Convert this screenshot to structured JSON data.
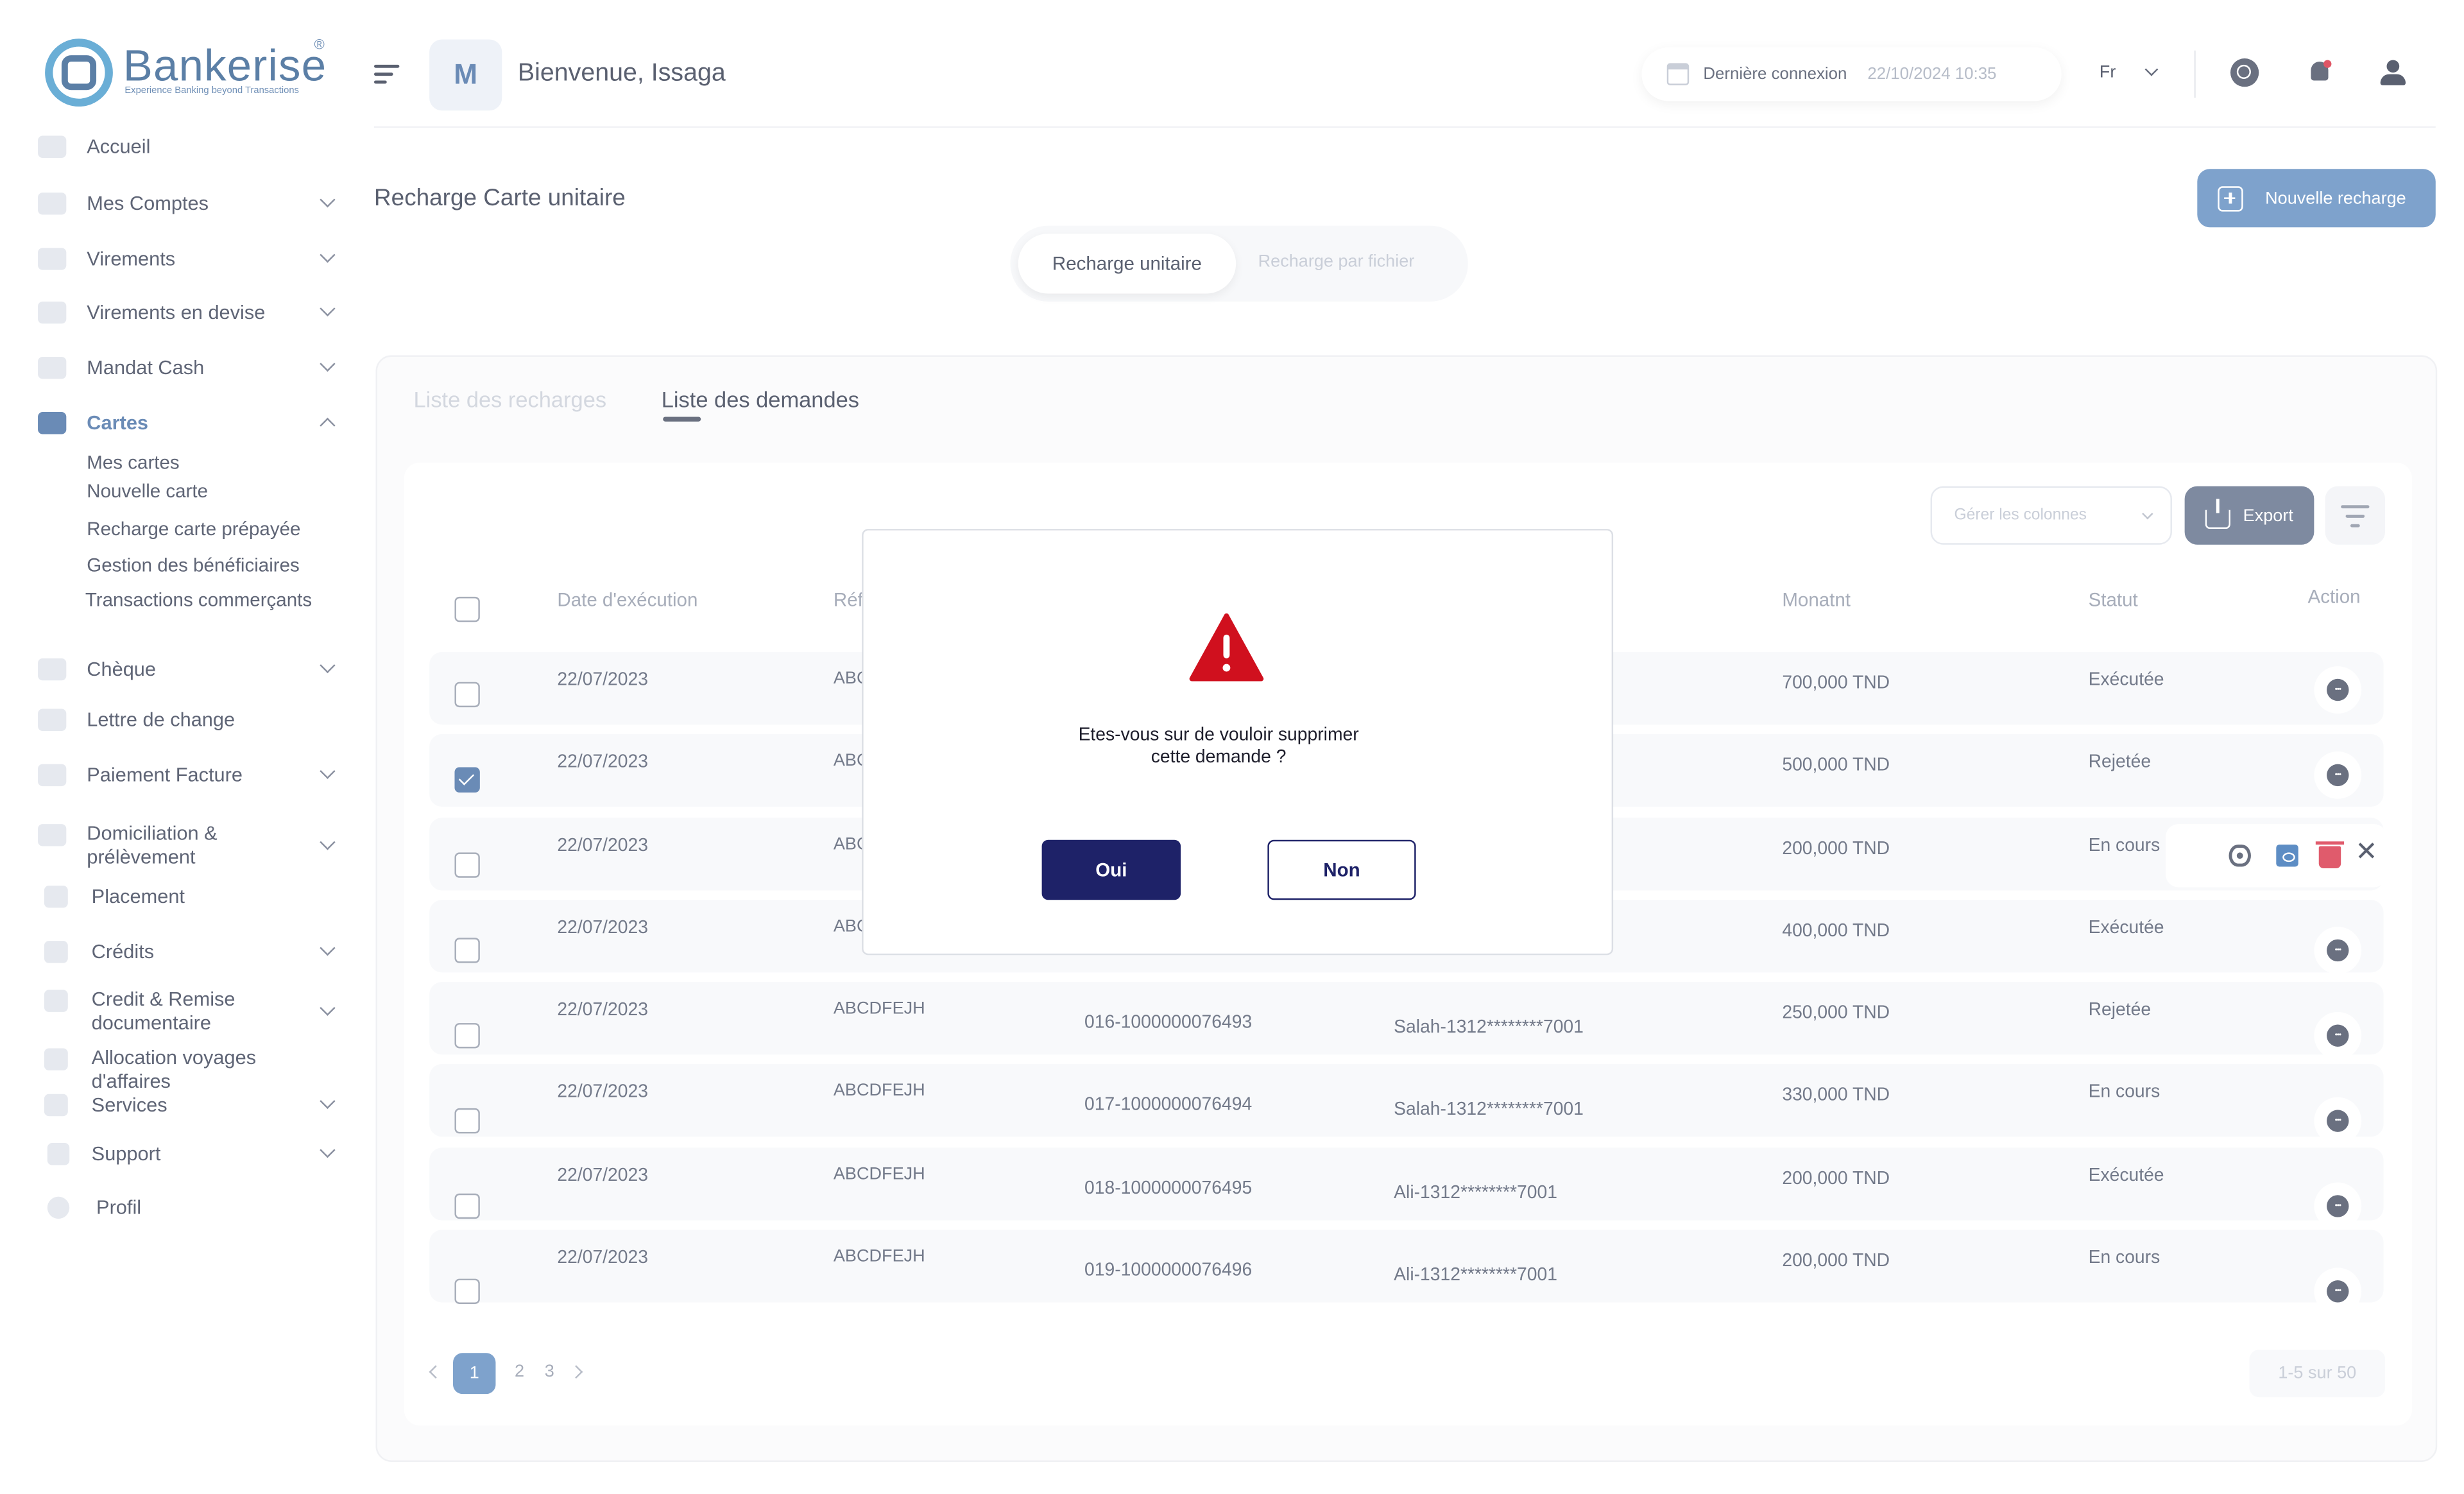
{
  "brand": {
    "name": "Bankerise",
    "tagline": "Experience Banking beyond Transactions",
    "reg": "®",
    "color": "#5b7fa6"
  },
  "sidebar": {
    "items": [
      {
        "label": "Accueil",
        "icon": "home-icon"
      },
      {
        "label": "Mes Comptes",
        "icon": "folder-icon"
      },
      {
        "label": "Virements",
        "icon": "transfer-icon"
      },
      {
        "label": "Virements en devise",
        "icon": "currency-icon"
      },
      {
        "label": "Mandat Cash",
        "icon": "mail-icon"
      },
      {
        "label": "Cartes",
        "icon": "card-icon",
        "active": true
      },
      {
        "label": "Chèque",
        "icon": "cheque-icon"
      },
      {
        "label": "Lettre de change",
        "icon": "letter-icon"
      },
      {
        "label": "Paiement Facture",
        "icon": "invoice-icon"
      },
      {
        "label": "Domiciliation & prélèvement",
        "icon": "domiciliation-icon"
      },
      {
        "label": "Placement",
        "icon": "chart-icon"
      },
      {
        "label": "Crédits",
        "icon": "credit-icon"
      },
      {
        "label": "Credit & Remise documentaire",
        "icon": "document-icon"
      },
      {
        "label": "Allocation voyages d'affaires",
        "icon": "travel-icon"
      },
      {
        "label": "Services",
        "icon": "services-icon"
      },
      {
        "label": "Support",
        "icon": "support-icon"
      },
      {
        "label": "Profil",
        "icon": "profile-icon"
      }
    ],
    "cartes_sub": [
      "Mes cartes",
      "Nouvelle carte",
      "Recharge carte prépayée",
      "Gestion des bénéficiaires",
      "Transactions commerçants"
    ]
  },
  "header": {
    "avatar_initial": "M",
    "welcome": "Bienvenue, Issaga",
    "last_login_label": "Dernière connexion",
    "last_login_date": "22/10/2024 10:35",
    "lang": "Fr"
  },
  "page": {
    "title": "Recharge Carte unitaire",
    "new_button": "Nouvelle recharge",
    "segments": [
      "Recharge unitaire",
      "Recharge par fichier"
    ],
    "tabs": [
      "Liste des recharges",
      "Liste des demandes"
    ],
    "active_tab": 1
  },
  "table": {
    "columns_select_placeholder": "Gérer les colonnes",
    "export_label": "Export",
    "headers": [
      "Date d'exécution",
      "Réf",
      "Monatnt",
      "Statut",
      "Action"
    ],
    "rows": [
      {
        "date": "22/07/2023",
        "ref": "ABC",
        "compte": "",
        "benef": "",
        "montant": "700,000 TND",
        "statut": "Exécutée",
        "checked": false
      },
      {
        "date": "22/07/2023",
        "ref": "ABC",
        "compte": "",
        "benef": "",
        "montant": "500,000 TND",
        "statut": "Rejetée",
        "checked": true
      },
      {
        "date": "22/07/2023",
        "ref": "ABC",
        "compte": "",
        "benef": "",
        "montant": "200,000 TND",
        "statut": "En cours",
        "checked": false
      },
      {
        "date": "22/07/2023",
        "ref": "ABC",
        "compte": "",
        "benef": "",
        "montant": "400,000 TND",
        "statut": "Exécutée",
        "checked": false
      },
      {
        "date": "22/07/2023",
        "ref": "ABCDFEJH",
        "compte": "016-1000000076493",
        "benef": "Salah-1312********7001",
        "montant": "250,000 TND",
        "statut": "Rejetée",
        "checked": false
      },
      {
        "date": "22/07/2023",
        "ref": "ABCDFEJH",
        "compte": "017-1000000076494",
        "benef": "Salah-1312********7001",
        "montant": "330,000 TND",
        "statut": "En cours",
        "checked": false
      },
      {
        "date": "22/07/2023",
        "ref": "ABCDFEJH",
        "compte": "018-1000000076495",
        "benef": "Ali-1312********7001",
        "montant": "200,000 TND",
        "statut": "Exécutée",
        "checked": false
      },
      {
        "date": "22/07/2023",
        "ref": "ABCDFEJH",
        "compte": "019-1000000076496",
        "benef": "Ali-1312********7001",
        "montant": "200,000 TND",
        "statut": "En cours",
        "checked": false
      }
    ]
  },
  "pagination": {
    "pages": [
      "1",
      "2",
      "3"
    ],
    "current": "1",
    "info": "1-5 sur 50"
  },
  "modal": {
    "message_line1": "Etes-vous sur de vouloir  supprimer",
    "message_line2": "cette demande  ?",
    "confirm": "Oui",
    "cancel": "Non",
    "icon": "warning-icon",
    "warning_color": "#d0101e"
  }
}
